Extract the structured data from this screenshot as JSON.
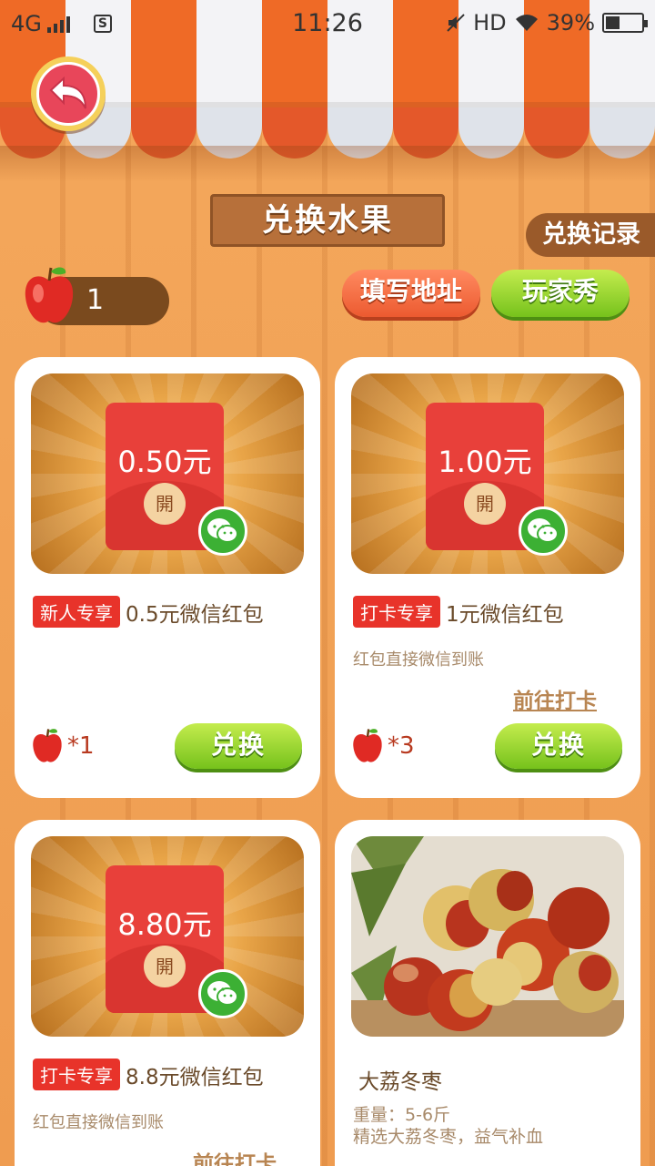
{
  "status_bar": {
    "network": "4G",
    "time": "11:26",
    "hd": "HD",
    "battery": "39%",
    "battery_level": 0.39
  },
  "header": {
    "title": "兑换水果",
    "records_label": "兑换记录"
  },
  "wallet": {
    "fruit_count": "1",
    "fill_address_label": "填写地址",
    "player_show_label": "玩家秀"
  },
  "cards": [
    {
      "amount": "0.50元",
      "open_label": "開",
      "tag": "新人专享",
      "name": "0.5元微信红包",
      "cost": "*1",
      "exchange_label": "兑换"
    },
    {
      "amount": "1.00元",
      "open_label": "開",
      "tag": "打卡专享",
      "name": "1元微信红包",
      "description": "红包直接微信到账",
      "goto_label": "前往打卡",
      "cost": "*3",
      "exchange_label": "兑换"
    },
    {
      "amount": "8.80元",
      "open_label": "開",
      "tag": "打卡专享",
      "name": "8.8元微信红包",
      "description": "红包直接微信到账",
      "goto_label": "前往打卡"
    },
    {
      "name": "大荔冬枣",
      "weight": "重量：5-6斤",
      "description": "精选大荔冬枣，益气补血"
    }
  ],
  "colors": {
    "background": "#f0a058",
    "awning_orange": "#ef6a26",
    "red_packet": "#e8403a",
    "tag_red": "#e8332a",
    "green_button": "#76c21c",
    "wechat_green": "#3cb034"
  },
  "icons": [
    "back-arrow-icon",
    "apple-icon",
    "wechat-icon",
    "signal-icon",
    "wifi-icon",
    "battery-icon"
  ]
}
